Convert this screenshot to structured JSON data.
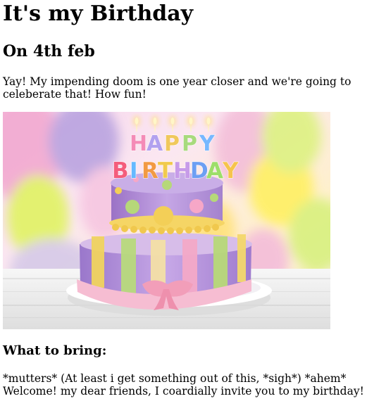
{
  "page": {
    "title": "It's my Birthday",
    "date": "On 4th feb",
    "intro": "Yay! My impending doom is one year closer and we're going to celeberate that! How fun!",
    "image": {
      "subject": "birthday-cake-image",
      "cake_letters_top": [
        "H",
        "A",
        "P",
        "P",
        "Y"
      ],
      "cake_letters_bottom": [
        "B",
        "I",
        "R",
        "T",
        "H",
        "D",
        "A",
        "Y"
      ],
      "colors": {
        "cake_lavender": "#b89ad8",
        "cake_dark_purple": "#8b6aba",
        "cake_green": "#b8d87a",
        "cake_yellow": "#f2d35e",
        "cake_pink": "#f3a6c7",
        "plate": "#f4f1f6"
      }
    },
    "section_heading": "What to bring:",
    "bring_text": "*mutters* (At least i get something out of this, *sigh*) *ahem* Welcome! my dear friends, I coardially invite you to my birthday!"
  }
}
